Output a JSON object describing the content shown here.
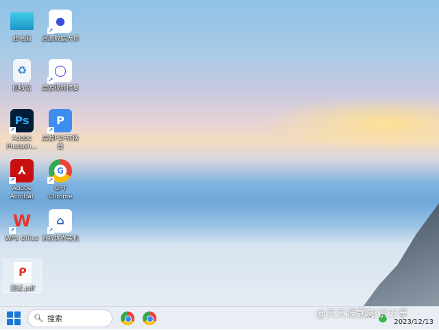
{
  "desktop_icons": [
    {
      "label": "此电脑",
      "icon": "monitor-icon"
    },
    {
      "label": "启源数据大师",
      "icon": "data-recovery-icon"
    },
    {
      "label": "回收站",
      "icon": "recycle-bin-icon"
    },
    {
      "label": "启源视频修复",
      "icon": "video-repair-icon"
    },
    {
      "label": "Adobe Photosh...",
      "icon": "photoshop-icon",
      "glyph": "Ps"
    },
    {
      "label": "启源PDF转换器",
      "icon": "pdf-converter-icon",
      "glyph": "P"
    },
    {
      "label": "Adobe Acrobat",
      "icon": "acrobat-icon"
    },
    {
      "label": "GPT Chrome",
      "icon": "chrome-icon",
      "glyph": "G"
    },
    {
      "label": "WPS Office",
      "icon": "wps-icon",
      "glyph": "W"
    },
    {
      "label": "系统世界装机",
      "icon": "system-install-icon"
    },
    {
      "label": "测试.pdf",
      "icon": "pdf-file-icon"
    }
  ],
  "taskbar": {
    "search_placeholder": "搜索",
    "date": "2023/12/13",
    "tray_chevron": "^"
  },
  "watermark": "@天天课题知识分享"
}
